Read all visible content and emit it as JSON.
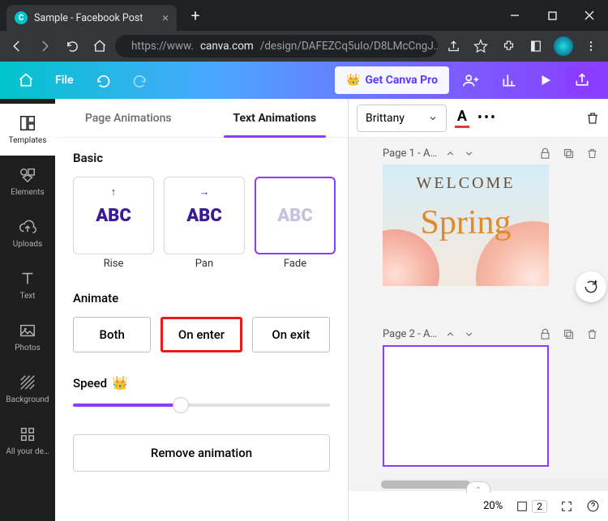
{
  "browser": {
    "tab_title": "Sample - Facebook Post",
    "url_display_host": "https://www.",
    "url_display_bold": "canva.com",
    "url_display_path": "/design/DAFEZCq5uIo/D8LMcCngJ…"
  },
  "toolbar": {
    "file": "File",
    "pro_button": "Get Canva Pro"
  },
  "vnav": {
    "templates": "Templates",
    "elements": "Elements",
    "uploads": "Uploads",
    "text": "Text",
    "photos": "Photos",
    "background": "Background",
    "all": "All your de…"
  },
  "anim": {
    "tab_page": "Page Animations",
    "tab_text": "Text Animations",
    "basic": "Basic",
    "rise": "Rise",
    "pan": "Pan",
    "fade": "Fade",
    "abc": "ABC",
    "animate": "Animate",
    "both": "Both",
    "on_enter": "On enter",
    "on_exit": "On exit",
    "speed": "Speed",
    "remove": "Remove animation"
  },
  "fontbar": {
    "font_name": "Brittany"
  },
  "pages": {
    "p1": "Page 1 - A…",
    "p2": "Page 2 - A…",
    "welcome": "WELCOME",
    "spring": "Spring"
  },
  "status": {
    "zoom": "20%",
    "page_count": "2"
  }
}
